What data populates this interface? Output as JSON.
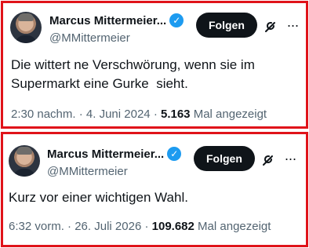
{
  "tweets": [
    {
      "display_name": "Marcus Mittermeier...",
      "handle": "@MMittermeier",
      "follow_label": "Folgen",
      "text": "Die wittert ne Verschwörung, wenn sie im Supermarkt eine Gurke  sieht.",
      "time": "2:30 nachm.",
      "date": "4. Juni 2024",
      "views_count": "5.163",
      "views_label": "Mal angezeigt",
      "separator": "·",
      "verified_glyph": "✓",
      "more_glyph": "···",
      "icons": [
        "avatar",
        "verified-badge-icon",
        "grok-icon",
        "more-icon"
      ]
    },
    {
      "display_name": "Marcus Mittermeier...",
      "handle": "@MMittermeier",
      "follow_label": "Folgen",
      "text": "Kurz vor einer wichtigen Wahl.",
      "time": "6:32 vorm.",
      "date": "26. Juli 2026",
      "views_count": "109.682",
      "views_label": "Mal angezeigt",
      "separator": "·",
      "verified_glyph": "✓",
      "more_glyph": "···",
      "icons": [
        "avatar",
        "verified-badge-icon",
        "grok-icon",
        "more-icon"
      ]
    }
  ],
  "colors": {
    "highlight_border": "#e0131a",
    "verified_blue": "#1d9bf0",
    "text_primary": "#0f1419",
    "text_secondary": "#536471",
    "button_bg": "#0f1419"
  }
}
